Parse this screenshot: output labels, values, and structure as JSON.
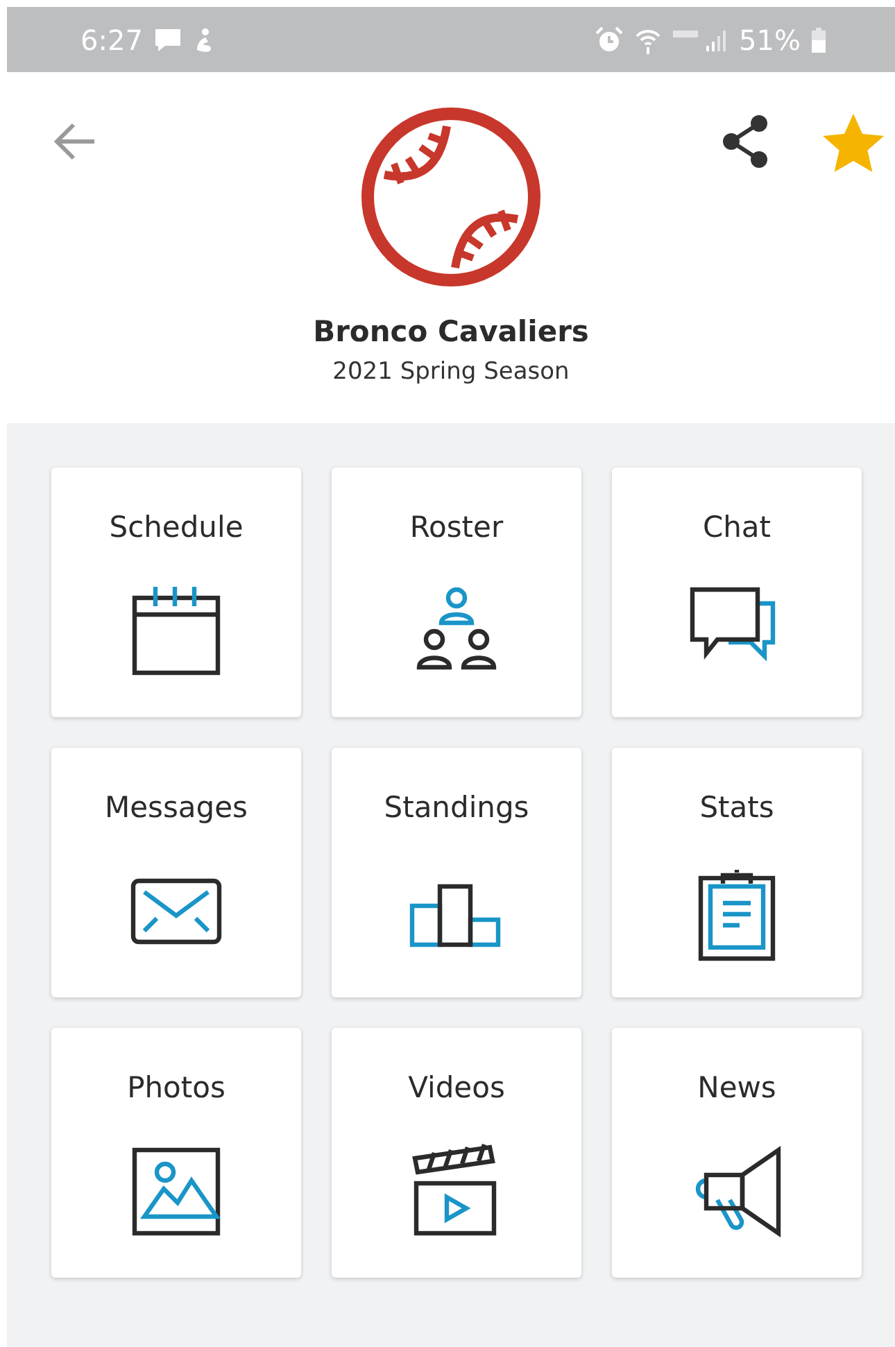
{
  "status_bar": {
    "time": "6:27",
    "battery": "51%"
  },
  "header": {
    "team_name": "Bronco Cavaliers",
    "season": "2021 Spring Season",
    "favorite": true
  },
  "tiles": [
    {
      "label": "Schedule",
      "kind": "calendar"
    },
    {
      "label": "Roster",
      "kind": "people"
    },
    {
      "label": "Chat",
      "kind": "chat"
    },
    {
      "label": "Messages",
      "kind": "envelope"
    },
    {
      "label": "Standings",
      "kind": "podium"
    },
    {
      "label": "Stats",
      "kind": "clipboard"
    },
    {
      "label": "Photos",
      "kind": "picture"
    },
    {
      "label": "Videos",
      "kind": "clapper"
    },
    {
      "label": "News",
      "kind": "megaphone"
    }
  ]
}
